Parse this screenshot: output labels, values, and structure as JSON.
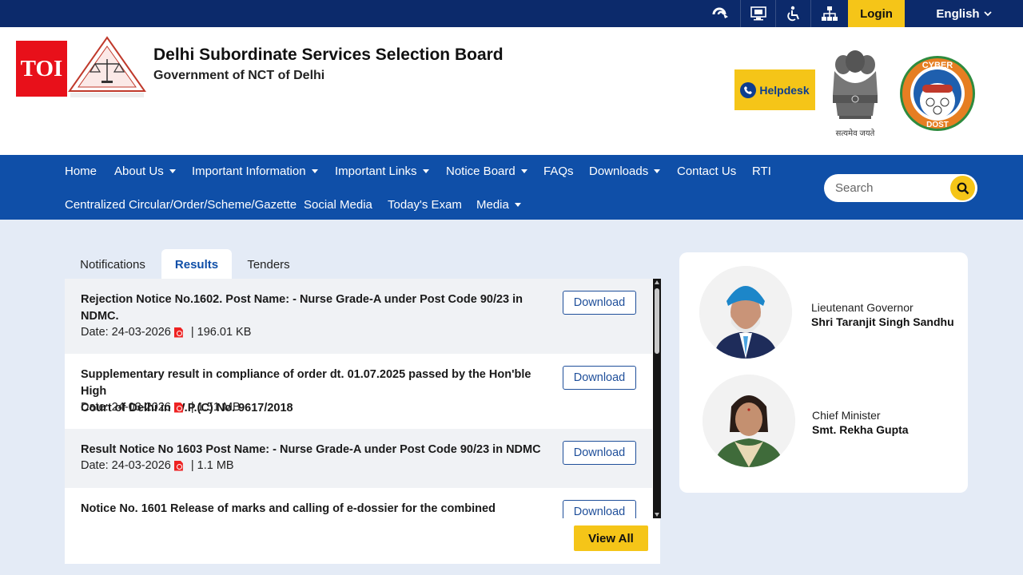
{
  "topbar": {
    "icons": [
      "screen-reader-icon",
      "monitor-icon",
      "accessibility-icon",
      "sitemap-icon"
    ],
    "login_label": "Login",
    "language": "English"
  },
  "header": {
    "toi_logo": "TOI",
    "title": "Delhi Subordinate Services Selection Board",
    "subtitle": "Government of NCT of Delhi",
    "helpdesk_label": "Helpdesk",
    "emblem_motto": "सत्यमेव जयते",
    "cyber_logo_text": [
      "CYBER",
      "DOST"
    ]
  },
  "nav": {
    "row1": [
      {
        "label": "Home",
        "dropdown": false
      },
      {
        "label": "About Us",
        "dropdown": true
      },
      {
        "label": "Important Information",
        "dropdown": true
      },
      {
        "label": "Important Links",
        "dropdown": true
      },
      {
        "label": "Notice Board",
        "dropdown": true
      },
      {
        "label": "FAQs",
        "dropdown": false
      },
      {
        "label": "Downloads",
        "dropdown": true
      },
      {
        "label": "Contact Us",
        "dropdown": false
      },
      {
        "label": "RTI",
        "dropdown": false
      }
    ],
    "row2": [
      {
        "label": "Centralized Circular/Order/Scheme/Gazette",
        "dropdown": false
      },
      {
        "label": "Social Media",
        "dropdown": false
      },
      {
        "label": "Today's Exam",
        "dropdown": false
      },
      {
        "label": "Media",
        "dropdown": true
      }
    ],
    "search_placeholder": "Search"
  },
  "tabs": [
    {
      "label": "Notifications",
      "active": false
    },
    {
      "label": "Results",
      "active": true
    },
    {
      "label": "Tenders",
      "active": false
    }
  ],
  "results": [
    {
      "title_lines": [
        "Rejection Notice No.1602. Post Name: - Nurse Grade-A under Post Code 90/23 in",
        "NDMC."
      ],
      "date": "Date: 24-03-2026",
      "size": "| 196.01 KB",
      "button": "Download"
    },
    {
      "title_lines": [
        "Supplementary result in compliance of order dt. 01.07.2025 passed by the Hon'ble High",
        "Court of Delhi in W.P.(C) No. 9617/2018"
      ],
      "date": "Date: 24-03-2026",
      "size": "| 1.51 MB",
      "button": "Download"
    },
    {
      "title_lines": [
        "Result Notice No 1603 Post Name: - Nurse Grade-A under Post Code 90/23 in NDMC"
      ],
      "date": "Date: 24-03-2026",
      "size": "| 1.1 MB",
      "button": "Download"
    },
    {
      "title_lines": [
        "Notice No. 1601 Release of marks and calling of e-dossier for the combined"
      ],
      "button": "Download"
    }
  ],
  "view_all_label": "View All",
  "officials": [
    {
      "role": "Lieutenant Governor",
      "name": "Shri Taranjit Singh Sandhu"
    },
    {
      "role": "Chief Minister",
      "name": "Smt. Rekha Gupta"
    }
  ],
  "colors": {
    "nav_blue": "#0f4fa8",
    "topbar_navy": "#0c2a6b",
    "accent_yellow": "#f5c518",
    "page_bg": "#e4ebf6"
  }
}
